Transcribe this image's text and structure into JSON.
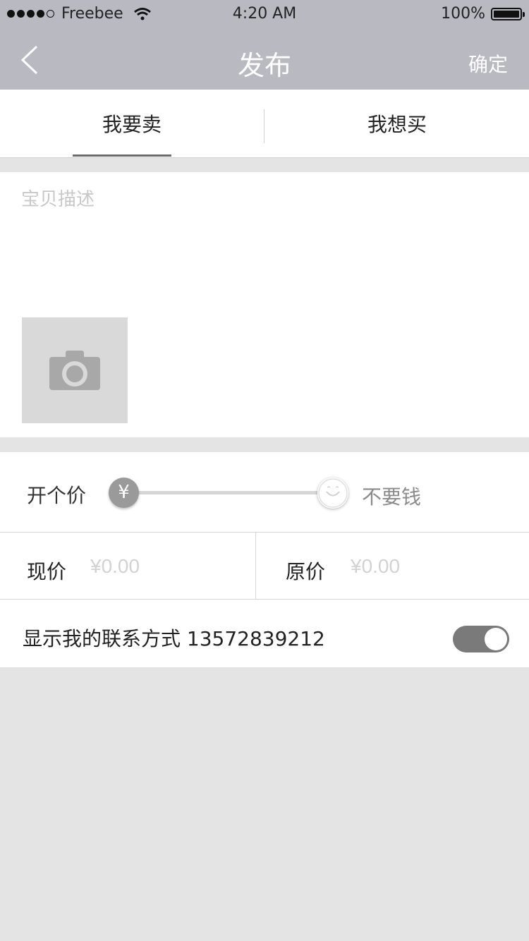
{
  "status_bar": {
    "carrier": "Freebee",
    "time": "4:20 AM",
    "battery": "100%"
  },
  "nav": {
    "title": "发布",
    "confirm": "确定"
  },
  "tabs": [
    {
      "label": "我要卖",
      "selected": true
    },
    {
      "label": "我想买",
      "selected": false
    }
  ],
  "description": {
    "placeholder": "宝贝描述"
  },
  "price": {
    "label": "开个价",
    "knob_symbol": "¥",
    "free_label": "不要钱",
    "current_label": "现价",
    "current_placeholder": "¥0.00",
    "original_label": "原价",
    "original_placeholder": "¥0.00"
  },
  "contact": {
    "label": "显示我的联系方式 13572839212",
    "toggle_on": true
  }
}
